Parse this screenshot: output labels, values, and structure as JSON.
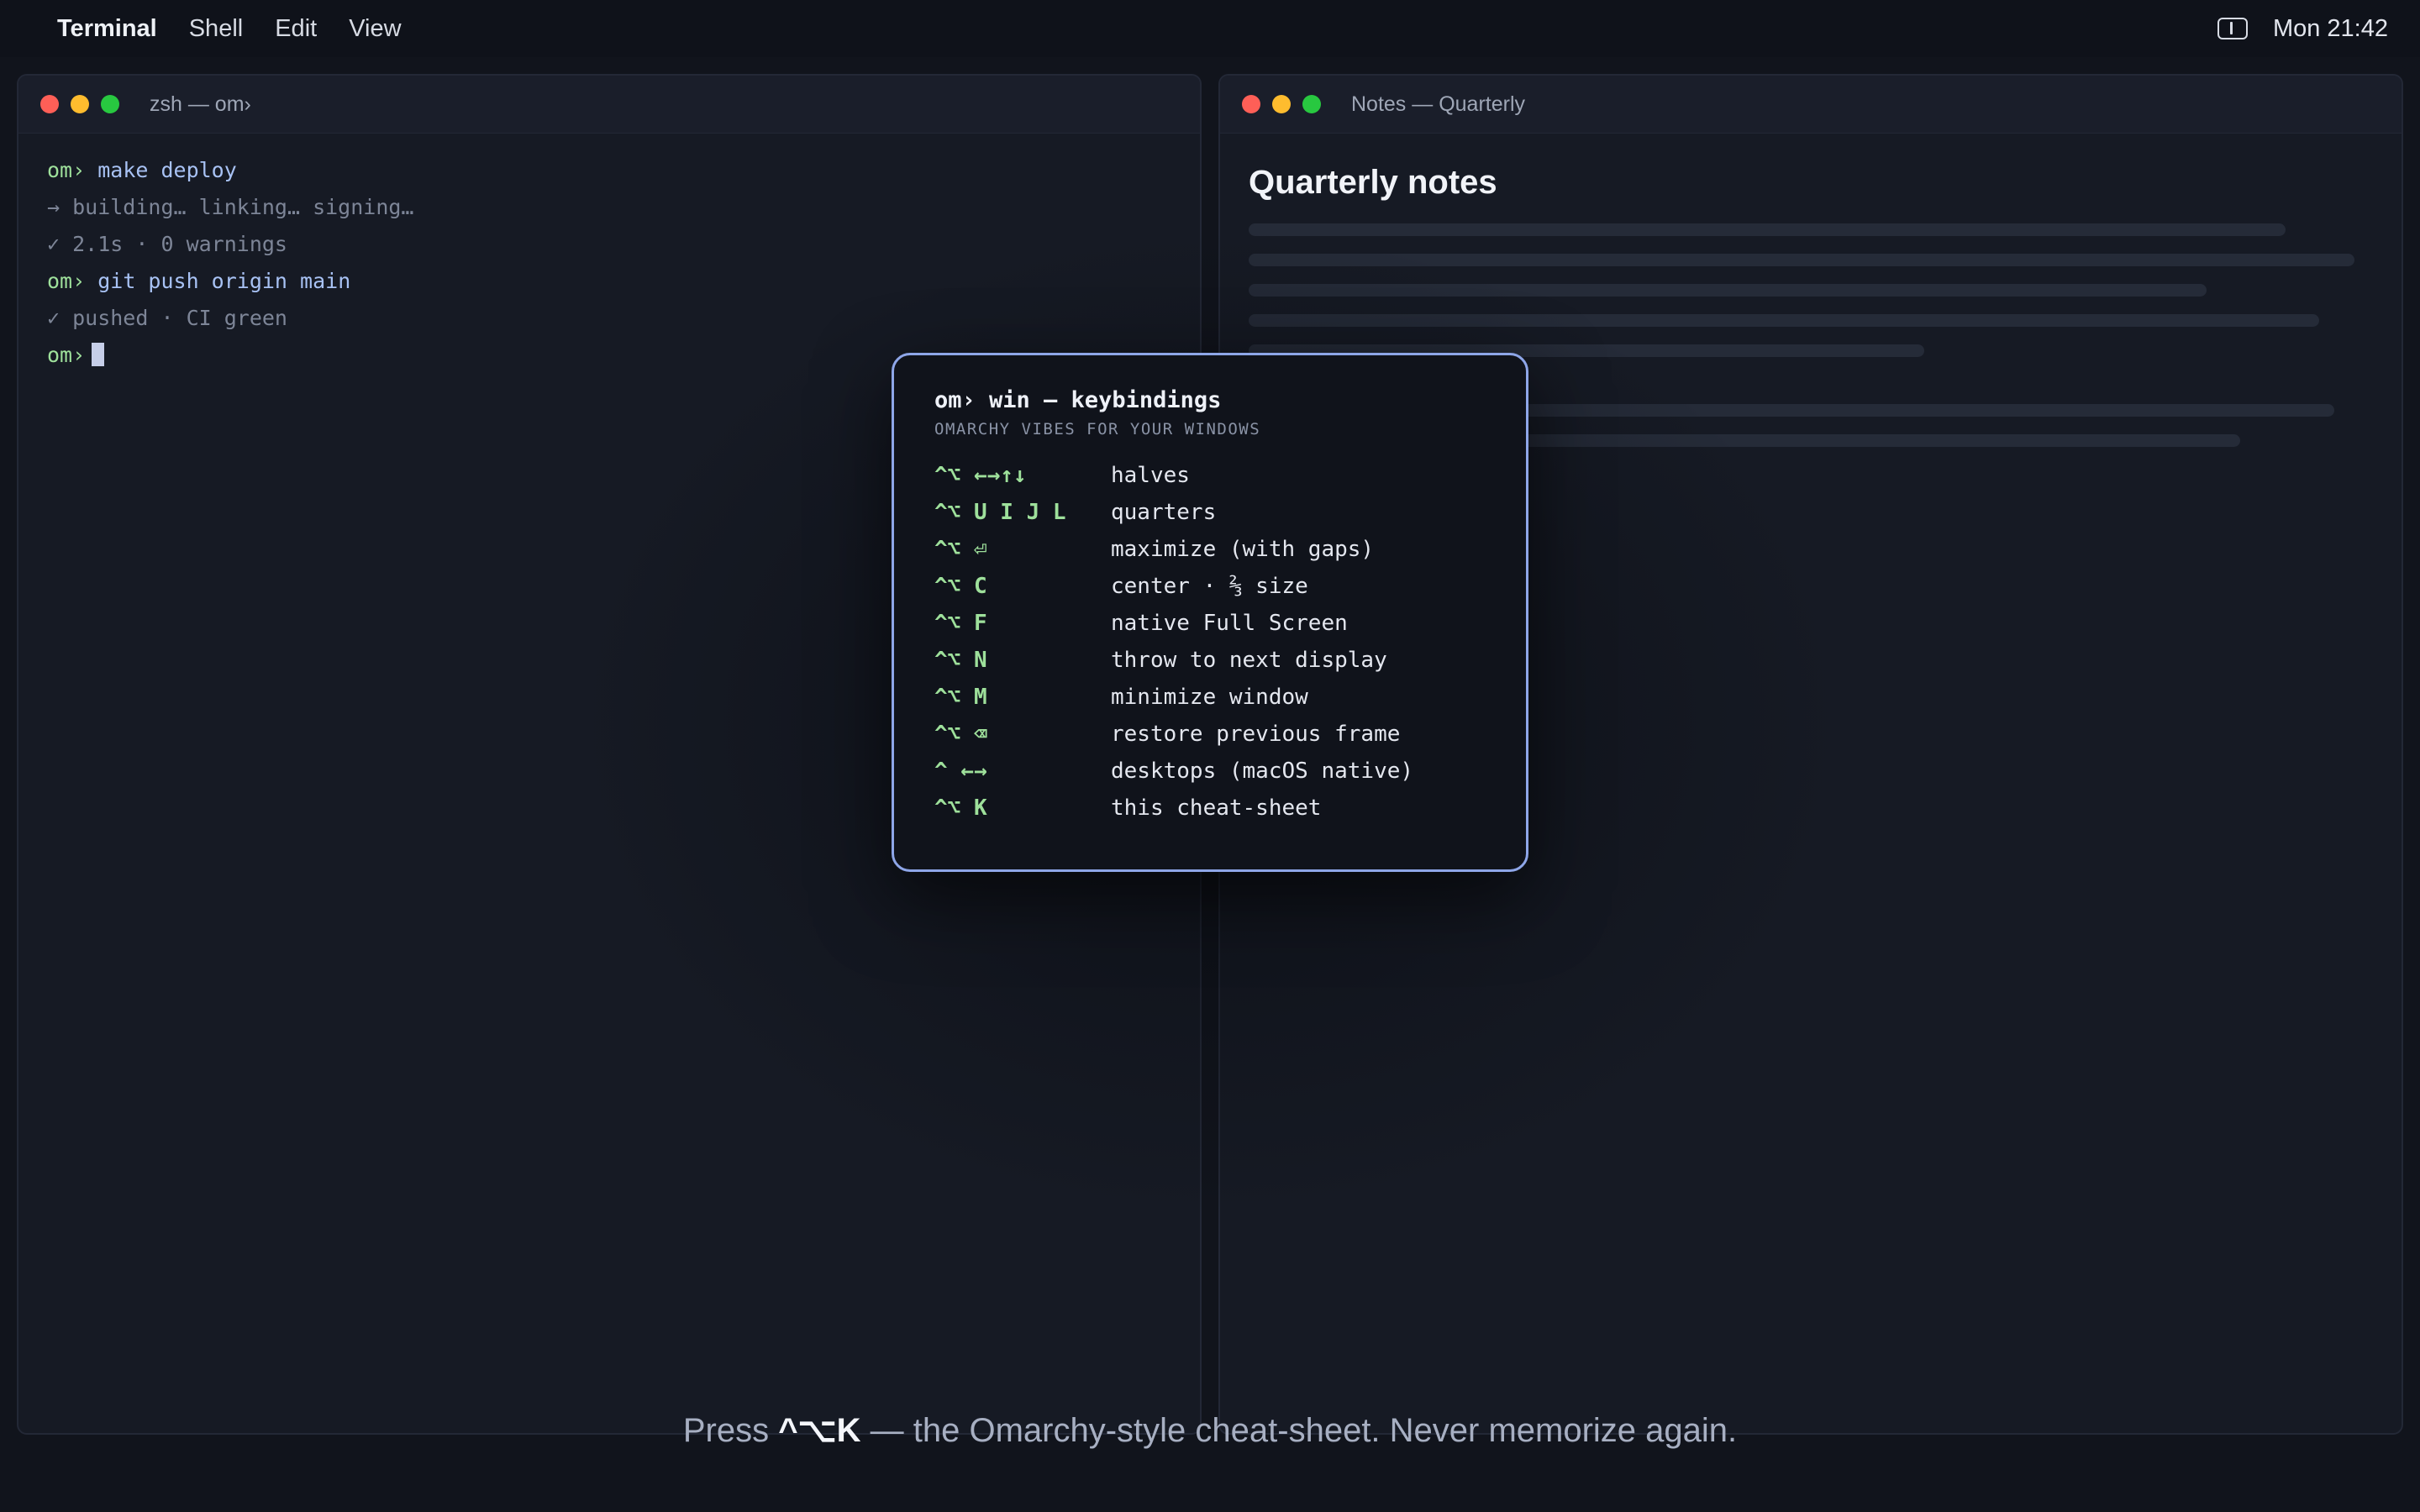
{
  "menubar": {
    "app_name": "Terminal",
    "menus": [
      "Shell",
      "Edit",
      "View"
    ],
    "clock": "Mon 21:42",
    "status_icon": "sidebar-toggle-icon"
  },
  "terminal_window": {
    "title": "zsh — om›",
    "lines": [
      {
        "prompt": "om›",
        "text": "make deploy",
        "kind": "cmd"
      },
      {
        "prompt": "",
        "text": "→ building… linking… signing…",
        "kind": "out"
      },
      {
        "prompt": "",
        "text": "✓ 2.1s · 0 warnings",
        "kind": "out"
      },
      {
        "prompt": "om›",
        "text": "git push origin main",
        "kind": "cmd"
      },
      {
        "prompt": "",
        "text": "✓ pushed · CI green",
        "kind": "out"
      },
      {
        "prompt": "om›",
        "text": "",
        "kind": "cursor"
      }
    ]
  },
  "notes_window": {
    "title": "Notes — Quarterly",
    "heading": "Quarterly notes"
  },
  "cheatsheet": {
    "title": "om› win — keybindings",
    "subtitle": "OMARCHY VIBES FOR YOUR WINDOWS",
    "bindings": [
      {
        "keys": "^⌥ ←→↑↓",
        "desc": "halves"
      },
      {
        "keys": "^⌥ U I J L",
        "desc": "quarters"
      },
      {
        "keys": "^⌥ ⏎",
        "desc": "maximize (with gaps)"
      },
      {
        "keys": "^⌥ C",
        "desc": "center · ⅔ size"
      },
      {
        "keys": "^⌥ F",
        "desc": "native Full Screen"
      },
      {
        "keys": "^⌥ N",
        "desc": "throw to next display"
      },
      {
        "keys": "^⌥ M",
        "desc": "minimize window"
      },
      {
        "keys": "^⌥ ⌫",
        "desc": "restore previous frame"
      },
      {
        "keys": "^ ←→",
        "desc": "desktops (macOS native)"
      },
      {
        "keys": "^⌥ K",
        "desc": "this cheat-sheet"
      }
    ]
  },
  "caption": {
    "before": "Press ",
    "shortcut": "^⌥K",
    "after": " — the Omarchy-style cheat-sheet. Never memorize again."
  },
  "colors": {
    "accent_border": "#8ea6e8",
    "key_green": "#9ee09b",
    "command_blue": "#a8c2f4"
  }
}
